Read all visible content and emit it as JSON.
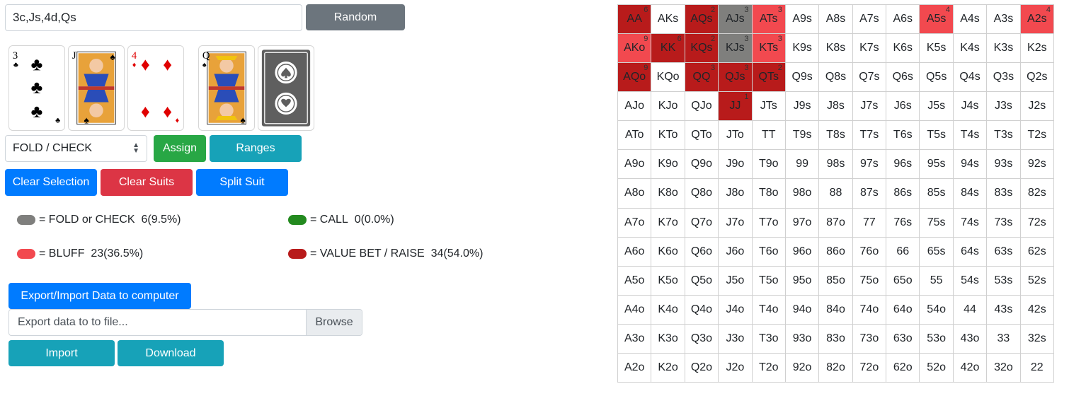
{
  "board": {
    "value": "3c,Js,4d,Qs"
  },
  "buttons": {
    "random": "Random",
    "assign": "Assign",
    "ranges": "Ranges",
    "clear_selection": "Clear Selection",
    "clear_suits": "Clear Suits",
    "split_suit": "Split Suit",
    "export_import": "Export/Import Data to computer",
    "browse": "Browse",
    "import": "Import",
    "download": "Download"
  },
  "cards": [
    {
      "rank": "3",
      "suit": "♣",
      "color": "#000000"
    },
    {
      "rank": "J",
      "suit": "♠",
      "color": "#000000"
    },
    {
      "rank": "4",
      "suit": "♦",
      "color": "#e00000"
    },
    {
      "rank": "Q",
      "suit": "♠",
      "color": "#000000"
    }
  ],
  "action_select": {
    "value": "FOLD / CHECK"
  },
  "legend": [
    {
      "label": "= FOLD or CHECK",
      "stat": "6(9.5%)",
      "color": "#7f7f7d"
    },
    {
      "label": "= CALL",
      "stat": "0(0.0%)",
      "color": "#238a1f"
    },
    {
      "label": "= BLUFF",
      "stat": "23(36.5%)",
      "color": "#f2494f"
    },
    {
      "label": "= VALUE BET / RAISE",
      "stat": "34(54.0%)",
      "color": "#b81b1b"
    }
  ],
  "file_input": {
    "placeholder": "Export data to to file..."
  },
  "grid": [
    [
      [
        "AA",
        "value",
        "6"
      ],
      [
        "AKs",
        "",
        ""
      ],
      [
        "AQs",
        "value",
        "2"
      ],
      [
        "AJs",
        "fold",
        "3"
      ],
      [
        "ATs",
        "bluff",
        "3"
      ],
      [
        "A9s",
        "",
        ""
      ],
      [
        "A8s",
        "",
        ""
      ],
      [
        "A7s",
        "",
        ""
      ],
      [
        "A6s",
        "",
        ""
      ],
      [
        "A5s",
        "bluff",
        "4"
      ],
      [
        "A4s",
        "",
        ""
      ],
      [
        "A3s",
        "",
        ""
      ],
      [
        "A2s",
        "bluff",
        "4"
      ]
    ],
    [
      [
        "AKo",
        "bluff",
        "9"
      ],
      [
        "KK",
        "value",
        "6"
      ],
      [
        "KQs",
        "value",
        "2"
      ],
      [
        "KJs",
        "fold",
        "3"
      ],
      [
        "KTs",
        "bluff",
        "3"
      ],
      [
        "K9s",
        "",
        ""
      ],
      [
        "K8s",
        "",
        ""
      ],
      [
        "K7s",
        "",
        ""
      ],
      [
        "K6s",
        "",
        ""
      ],
      [
        "K5s",
        "",
        ""
      ],
      [
        "K4s",
        "",
        ""
      ],
      [
        "K3s",
        "",
        ""
      ],
      [
        "K2s",
        "",
        ""
      ]
    ],
    [
      [
        "AQo",
        "value",
        "9"
      ],
      [
        "KQo",
        "",
        ""
      ],
      [
        "QQ",
        "value",
        "3"
      ],
      [
        "QJs",
        "value",
        "3"
      ],
      [
        "QTs",
        "value",
        "2"
      ],
      [
        "Q9s",
        "",
        ""
      ],
      [
        "Q8s",
        "",
        ""
      ],
      [
        "Q7s",
        "",
        ""
      ],
      [
        "Q6s",
        "",
        ""
      ],
      [
        "Q5s",
        "",
        ""
      ],
      [
        "Q4s",
        "",
        ""
      ],
      [
        "Q3s",
        "",
        ""
      ],
      [
        "Q2s",
        "",
        ""
      ]
    ],
    [
      [
        "AJo",
        "",
        ""
      ],
      [
        "KJo",
        "",
        ""
      ],
      [
        "QJo",
        "",
        ""
      ],
      [
        "JJ",
        "value",
        "1"
      ],
      [
        "JTs",
        "",
        ""
      ],
      [
        "J9s",
        "",
        ""
      ],
      [
        "J8s",
        "",
        ""
      ],
      [
        "J7s",
        "",
        ""
      ],
      [
        "J6s",
        "",
        ""
      ],
      [
        "J5s",
        "",
        ""
      ],
      [
        "J4s",
        "",
        ""
      ],
      [
        "J3s",
        "",
        ""
      ],
      [
        "J2s",
        "",
        ""
      ]
    ],
    [
      [
        "ATo",
        "",
        ""
      ],
      [
        "KTo",
        "",
        ""
      ],
      [
        "QTo",
        "",
        ""
      ],
      [
        "JTo",
        "",
        ""
      ],
      [
        "TT",
        "",
        ""
      ],
      [
        "T9s",
        "",
        ""
      ],
      [
        "T8s",
        "",
        ""
      ],
      [
        "T7s",
        "",
        ""
      ],
      [
        "T6s",
        "",
        ""
      ],
      [
        "T5s",
        "",
        ""
      ],
      [
        "T4s",
        "",
        ""
      ],
      [
        "T3s",
        "",
        ""
      ],
      [
        "T2s",
        "",
        ""
      ]
    ],
    [
      [
        "A9o",
        "",
        ""
      ],
      [
        "K9o",
        "",
        ""
      ],
      [
        "Q9o",
        "",
        ""
      ],
      [
        "J9o",
        "",
        ""
      ],
      [
        "T9o",
        "",
        ""
      ],
      [
        "99",
        "",
        ""
      ],
      [
        "98s",
        "",
        ""
      ],
      [
        "97s",
        "",
        ""
      ],
      [
        "96s",
        "",
        ""
      ],
      [
        "95s",
        "",
        ""
      ],
      [
        "94s",
        "",
        ""
      ],
      [
        "93s",
        "",
        ""
      ],
      [
        "92s",
        "",
        ""
      ]
    ],
    [
      [
        "A8o",
        "",
        ""
      ],
      [
        "K8o",
        "",
        ""
      ],
      [
        "Q8o",
        "",
        ""
      ],
      [
        "J8o",
        "",
        ""
      ],
      [
        "T8o",
        "",
        ""
      ],
      [
        "98o",
        "",
        ""
      ],
      [
        "88",
        "",
        ""
      ],
      [
        "87s",
        "",
        ""
      ],
      [
        "86s",
        "",
        ""
      ],
      [
        "85s",
        "",
        ""
      ],
      [
        "84s",
        "",
        ""
      ],
      [
        "83s",
        "",
        ""
      ],
      [
        "82s",
        "",
        ""
      ]
    ],
    [
      [
        "A7o",
        "",
        ""
      ],
      [
        "K7o",
        "",
        ""
      ],
      [
        "Q7o",
        "",
        ""
      ],
      [
        "J7o",
        "",
        ""
      ],
      [
        "T7o",
        "",
        ""
      ],
      [
        "97o",
        "",
        ""
      ],
      [
        "87o",
        "",
        ""
      ],
      [
        "77",
        "",
        ""
      ],
      [
        "76s",
        "",
        ""
      ],
      [
        "75s",
        "",
        ""
      ],
      [
        "74s",
        "",
        ""
      ],
      [
        "73s",
        "",
        ""
      ],
      [
        "72s",
        "",
        ""
      ]
    ],
    [
      [
        "A6o",
        "",
        ""
      ],
      [
        "K6o",
        "",
        ""
      ],
      [
        "Q6o",
        "",
        ""
      ],
      [
        "J6o",
        "",
        ""
      ],
      [
        "T6o",
        "",
        ""
      ],
      [
        "96o",
        "",
        ""
      ],
      [
        "86o",
        "",
        ""
      ],
      [
        "76o",
        "",
        ""
      ],
      [
        "66",
        "",
        ""
      ],
      [
        "65s",
        "",
        ""
      ],
      [
        "64s",
        "",
        ""
      ],
      [
        "63s",
        "",
        ""
      ],
      [
        "62s",
        "",
        ""
      ]
    ],
    [
      [
        "A5o",
        "",
        ""
      ],
      [
        "K5o",
        "",
        ""
      ],
      [
        "Q5o",
        "",
        ""
      ],
      [
        "J5o",
        "",
        ""
      ],
      [
        "T5o",
        "",
        ""
      ],
      [
        "95o",
        "",
        ""
      ],
      [
        "85o",
        "",
        ""
      ],
      [
        "75o",
        "",
        ""
      ],
      [
        "65o",
        "",
        ""
      ],
      [
        "55",
        "",
        ""
      ],
      [
        "54s",
        "",
        ""
      ],
      [
        "53s",
        "",
        ""
      ],
      [
        "52s",
        "",
        ""
      ]
    ],
    [
      [
        "A4o",
        "",
        ""
      ],
      [
        "K4o",
        "",
        ""
      ],
      [
        "Q4o",
        "",
        ""
      ],
      [
        "J4o",
        "",
        ""
      ],
      [
        "T4o",
        "",
        ""
      ],
      [
        "94o",
        "",
        ""
      ],
      [
        "84o",
        "",
        ""
      ],
      [
        "74o",
        "",
        ""
      ],
      [
        "64o",
        "",
        ""
      ],
      [
        "54o",
        "",
        ""
      ],
      [
        "44",
        "",
        ""
      ],
      [
        "43s",
        "",
        ""
      ],
      [
        "42s",
        "",
        ""
      ]
    ],
    [
      [
        "A3o",
        "",
        ""
      ],
      [
        "K3o",
        "",
        ""
      ],
      [
        "Q3o",
        "",
        ""
      ],
      [
        "J3o",
        "",
        ""
      ],
      [
        "T3o",
        "",
        ""
      ],
      [
        "93o",
        "",
        ""
      ],
      [
        "83o",
        "",
        ""
      ],
      [
        "73o",
        "",
        ""
      ],
      [
        "63o",
        "",
        ""
      ],
      [
        "53o",
        "",
        ""
      ],
      [
        "43o",
        "",
        ""
      ],
      [
        "33",
        "",
        ""
      ],
      [
        "32s",
        "",
        ""
      ]
    ],
    [
      [
        "A2o",
        "",
        ""
      ],
      [
        "K2o",
        "",
        ""
      ],
      [
        "Q2o",
        "",
        ""
      ],
      [
        "J2o",
        "",
        ""
      ],
      [
        "T2o",
        "",
        ""
      ],
      [
        "92o",
        "",
        ""
      ],
      [
        "82o",
        "",
        ""
      ],
      [
        "72o",
        "",
        ""
      ],
      [
        "62o",
        "",
        ""
      ],
      [
        "52o",
        "",
        ""
      ],
      [
        "42o",
        "",
        ""
      ],
      [
        "32o",
        "",
        ""
      ],
      [
        "22",
        "",
        ""
      ]
    ]
  ]
}
